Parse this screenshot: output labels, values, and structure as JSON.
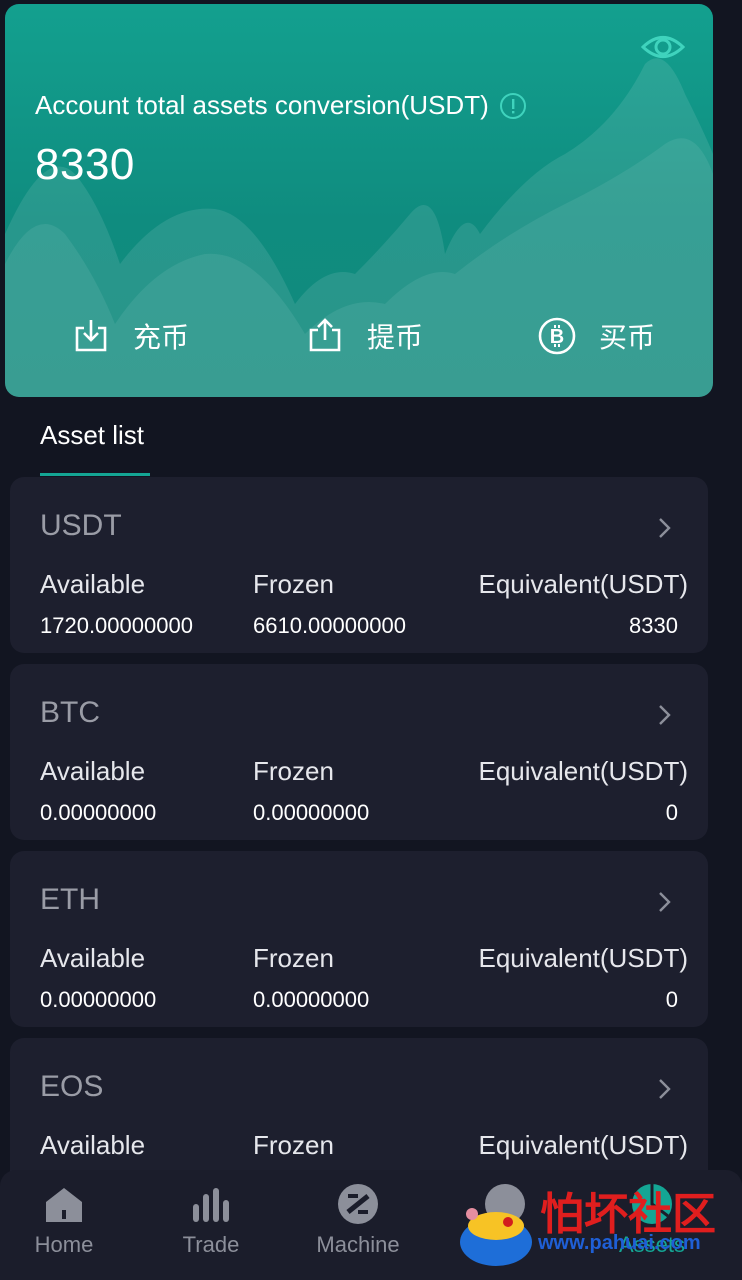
{
  "hero": {
    "title": "Account total assets conversion(USDT)",
    "total": "8330",
    "actions": [
      {
        "label": "充币",
        "icon": "deposit-icon"
      },
      {
        "label": "提币",
        "icon": "withdraw-icon"
      },
      {
        "label": "买币",
        "icon": "bitcoin-icon"
      }
    ],
    "accent": "#13a08f"
  },
  "tab": {
    "label": "Asset list"
  },
  "columns": {
    "available": "Available",
    "frozen": "Frozen",
    "equivalent": "Equivalent(USDT)"
  },
  "assets": [
    {
      "coin": "USDT",
      "available": "1720.00000000",
      "frozen": "6610.00000000",
      "equivalent": "8330"
    },
    {
      "coin": "BTC",
      "available": "0.00000000",
      "frozen": "0.00000000",
      "equivalent": "0"
    },
    {
      "coin": "ETH",
      "available": "0.00000000",
      "frozen": "0.00000000",
      "equivalent": "0"
    },
    {
      "coin": "EOS",
      "available": "",
      "frozen": "",
      "equivalent": ""
    }
  ],
  "nav": [
    {
      "label": "Home",
      "icon": "home-icon"
    },
    {
      "label": "Trade",
      "icon": "trade-icon"
    },
    {
      "label": "Machine",
      "icon": "machine-icon"
    },
    {
      "label": "...act",
      "icon": "contract-icon"
    },
    {
      "label": "Assets",
      "icon": "assets-icon"
    }
  ],
  "watermark": {
    "title": "怕坏社区",
    "url": "www.pahuai.com"
  }
}
